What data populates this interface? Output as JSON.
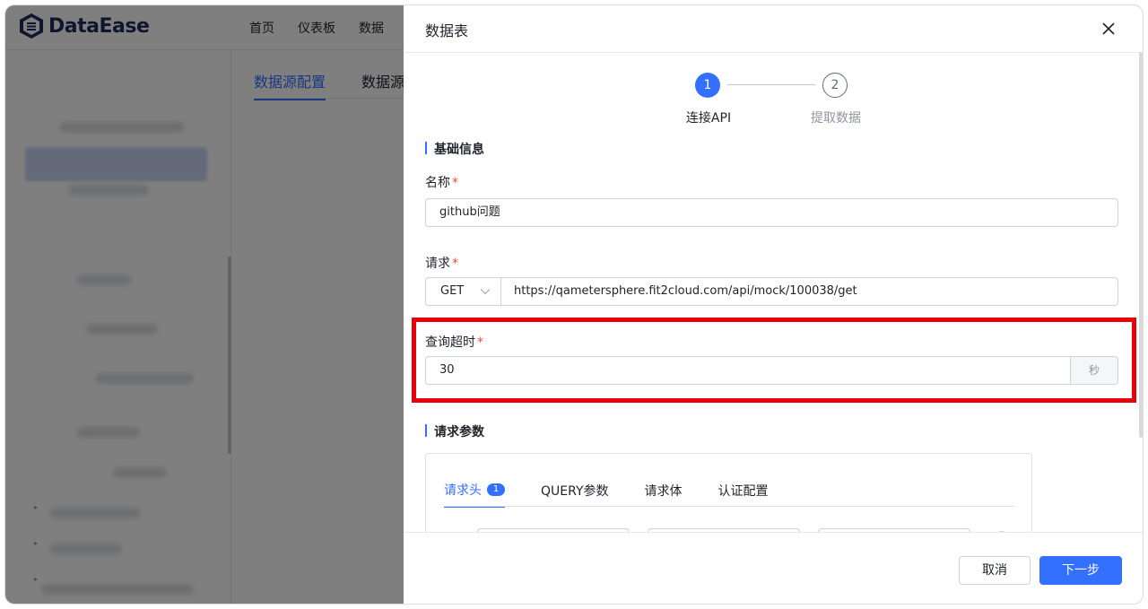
{
  "app": {
    "brand": "DataEase",
    "nav": [
      "首页",
      "仪表板",
      "数据"
    ],
    "tabs": [
      "数据源配置",
      "数据源"
    ]
  },
  "drawer": {
    "title": "数据表",
    "steps": [
      {
        "number": "1",
        "label": "连接API",
        "active": true
      },
      {
        "number": "2",
        "label": "提取数据",
        "active": false
      }
    ],
    "basic_info": {
      "title": "基础信息",
      "name_label": "名称",
      "name_value": "github问题",
      "request_label": "请求",
      "method": "GET",
      "url": "https://qametersphere.fit2cloud.com/api/mock/100038/get",
      "timeout_label": "查询超时",
      "timeout_value": "30",
      "timeout_unit": "秒",
      "required_mark": "*"
    },
    "request_params": {
      "title": "请求参数",
      "tabs": [
        {
          "label": "请求头",
          "badge": "1"
        },
        {
          "label": "QUERY参数"
        },
        {
          "label": "请求体"
        },
        {
          "label": "认证配置"
        }
      ]
    },
    "footer": {
      "cancel": "取消",
      "next": "下一步"
    }
  },
  "colors": {
    "accent": "#3370ff",
    "highlight": "#e8000b",
    "required": "#f54a45"
  }
}
